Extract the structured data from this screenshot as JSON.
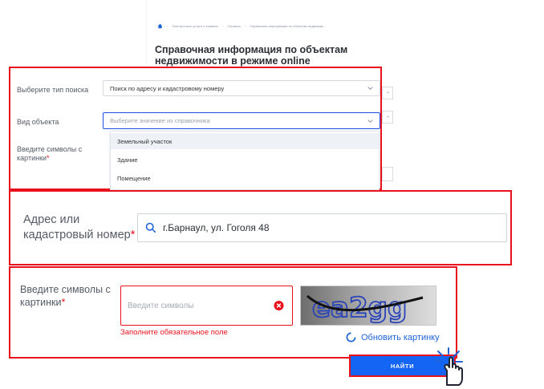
{
  "breadcrumb": {
    "items": [
      "Электронные услуги и сервисы",
      "Сервисы",
      "Справочная информация по объектам недвижим..."
    ]
  },
  "page": {
    "title": "Справочная информация по объектам недвижимости в режиме online"
  },
  "form_zoom1": {
    "search_type_label": "Выберите тип поиска",
    "search_type_value": "Поиск по адресу и кадастровому номеру",
    "object_type_label": "Вид объекта",
    "object_type_placeholder": "Выберите значение из справочника",
    "captcha_label": "Введите символы с картинки",
    "required_mark": "*",
    "dropdown_options": [
      "Земельный участок",
      "Здание",
      "Помещение"
    ]
  },
  "form_zoom2": {
    "address_label": "Адрес или кадастровый номер",
    "required_mark": "*",
    "address_value": "г.Барнаул, ул. Гоголя 48"
  },
  "form_zoom3": {
    "captcha_label": "Введите символы с картинки",
    "required_mark": "*",
    "captcha_placeholder": "Введите символы",
    "error_text": "Заполните обязательное поле",
    "captcha_text": "ea2gg",
    "refresh_label": "Обновить картинку"
  },
  "actions": {
    "find_label": "НАЙТИ"
  },
  "colors": {
    "highlight_red": "#e8121c",
    "primary_blue": "#1565f5",
    "link_blue": "#1e62d6"
  },
  "icons": [
    "home-icon",
    "search-icon",
    "chevron-down-icon",
    "error-clear-icon",
    "refresh-icon",
    "pointer-hand-icon"
  ]
}
